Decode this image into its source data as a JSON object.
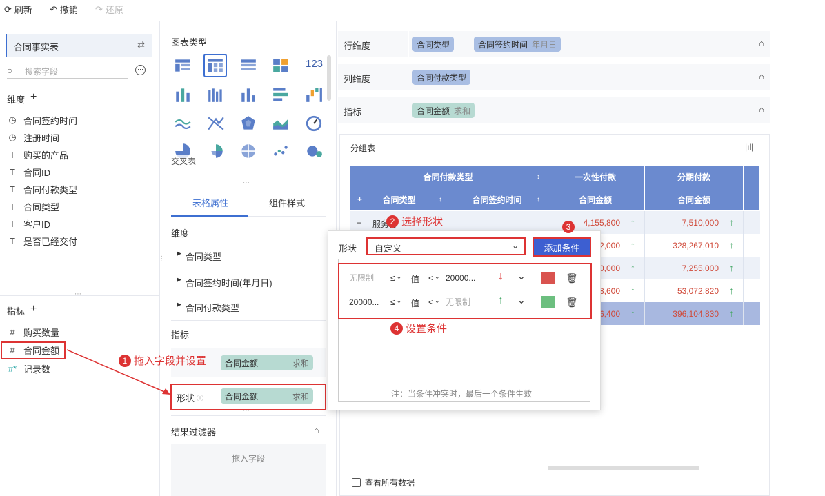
{
  "toolbar": {
    "refresh": "刷新",
    "undo": "撤销",
    "redo": "还原"
  },
  "left": {
    "dataset": "合同事实表",
    "search_placeholder": "搜索字段",
    "dimension_title": "维度",
    "dimensions": [
      "合同签约时间",
      "注册时间",
      "购买的产品",
      "合同ID",
      "合同付款类型",
      "合同类型",
      "客户ID",
      "是否已经交付"
    ],
    "measure_title": "指标",
    "measures": [
      "购买数量",
      "合同金额",
      "记录数"
    ]
  },
  "mid": {
    "chart_type_title": "图表类型",
    "chart_hover": "交叉表",
    "tab_table": "表格属性",
    "tab_style": "组件样式",
    "dim_title": "维度",
    "dim_items": [
      "合同类型",
      "合同签约时间(年月日)",
      "合同付款类型"
    ],
    "measure_title": "指标",
    "measure_field": "合同金额",
    "measure_agg": "求和",
    "shape_label": "形状",
    "shape_field": "合同金额",
    "shape_agg": "求和",
    "filter_title": "结果过滤器",
    "filter_drop": "拖入字段"
  },
  "shelves": {
    "row_label": "行维度",
    "row_pill1": "合同类型",
    "row_pill2": "合同签约时间",
    "row_pill2_sub": "年月日",
    "col_label": "列维度",
    "col_pill": "合同付款类型",
    "measure_label": "指标",
    "measure_pill": "合同金额",
    "measure_pill_sub": "求和"
  },
  "table": {
    "title": "分组表",
    "h_paytype": "合同付款类型",
    "h_contract_type": "合同类型",
    "h_sign_time": "合同签约时间",
    "h_onetime": "一次性付款",
    "h_installment": "分期付款",
    "h_amount1": "合同金额",
    "h_amount2": "合同金额",
    "row1_label": "服务协",
    "rows": [
      {
        "a": "4,155,800",
        "b": "7,510,000"
      },
      {
        "a": "2,000",
        "b": "328,267,010"
      },
      {
        "a": "0,000",
        "b": "7,255,000"
      },
      {
        "a": "8,600",
        "b": "53,072,820"
      },
      {
        "a": "6,400",
        "b": "396,104,830"
      }
    ],
    "view_all": "查看所有数据"
  },
  "dialog": {
    "shape_label": "形状",
    "shape_value": "自定义",
    "add_button": "添加条件",
    "cond1_from": "无限制",
    "cond1_op1": "≤",
    "cond1_val": "值",
    "cond1_op2": "<",
    "cond1_to": "20000...",
    "cond2_from": "20000...",
    "cond2_op1": "≤",
    "cond2_val": "值",
    "cond2_op2": "<",
    "cond2_to": "无限制",
    "note": "注：当条件冲突时，最后一个条件生效",
    "color_red": "#d9534f",
    "color_green": "#6cbf7f"
  },
  "annotations": {
    "a1_num": "1",
    "a1": "拖入字段并设置",
    "a2_num": "2",
    "a2": "选择形状",
    "a3_num": "3",
    "a4_num": "4",
    "a4": "设置条件"
  }
}
